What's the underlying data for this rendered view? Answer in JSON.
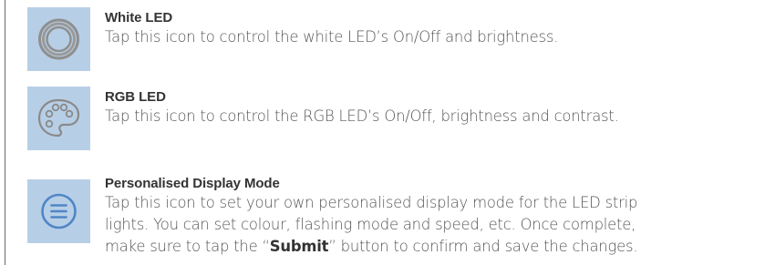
{
  "items": [
    {
      "icon": "ring-icon",
      "title": "White LED",
      "description": "Tap this icon to control the white LED’s On/Off and brightness."
    },
    {
      "icon": "palette-icon",
      "title": "RGB LED",
      "description": "Tap this icon to control the RGB LED’s On/Off, brightness and contrast."
    },
    {
      "icon": "menu-circle-icon",
      "title": "Personalised Display Mode",
      "description_lines": [
        "Tap this icon to set your own personalised display mode for the LED strip",
        "lights. You can set colour, flashing mode and speed, etc. Once complete,"
      ],
      "description_last_before": "make sure to tap the “",
      "description_bold": "Submit",
      "description_last_after": "” button to confirm and save the changes."
    }
  ],
  "colors": {
    "icon_background": "#b7cfe6",
    "icon_stroke": "#8c8c8c",
    "menu_icon_stroke": "#4f86c6",
    "title_text": "#333333",
    "body_text": "#555555"
  }
}
